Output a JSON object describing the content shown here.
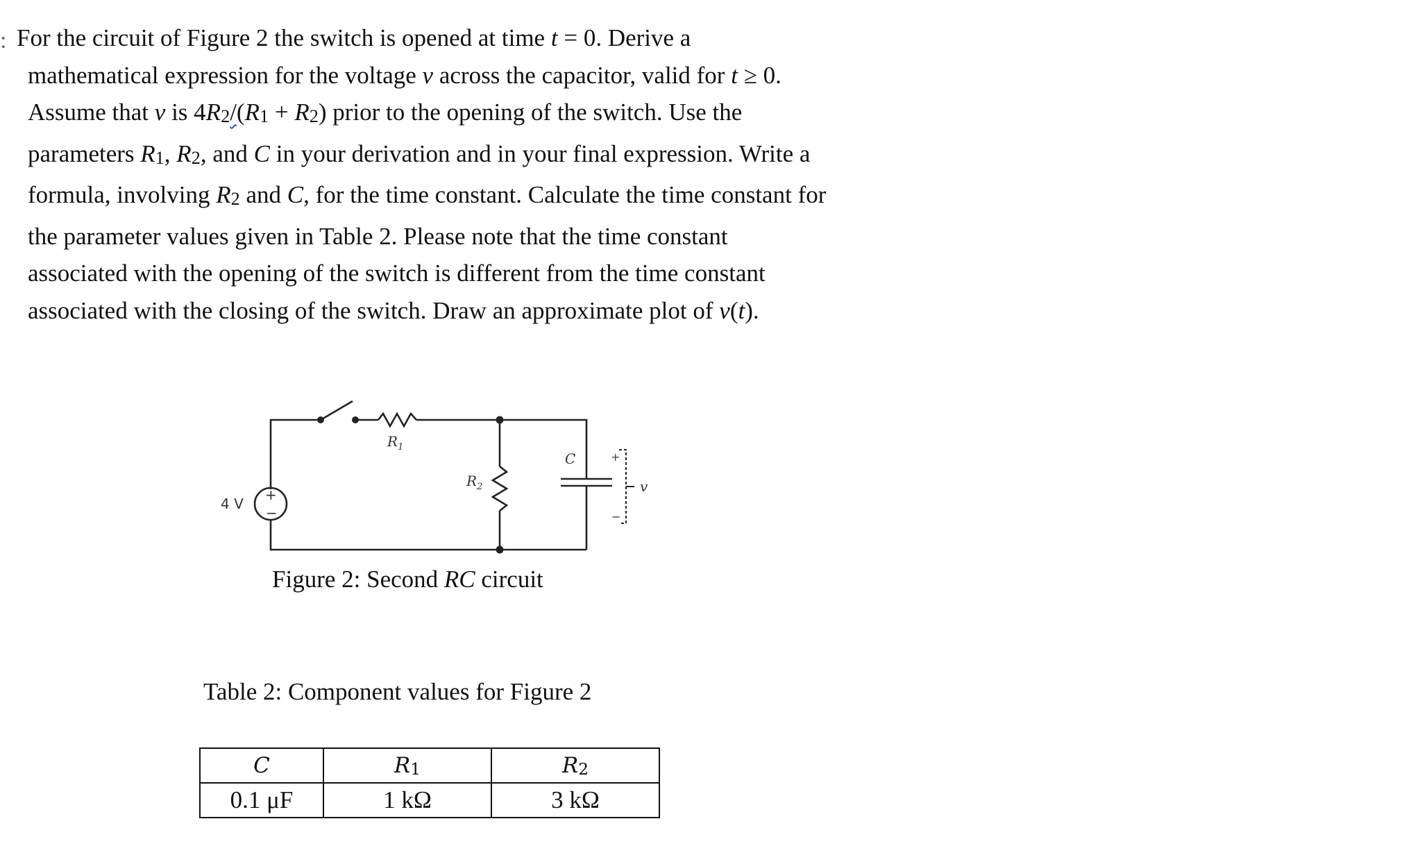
{
  "problem": {
    "bullet": ":",
    "lines": [
      {
        "parts": [
          "For the circuit of Figure 2 the switch is opened at time ",
          {
            "math": "t"
          },
          " = 0.  Derive a"
        ]
      },
      {
        "parts": [
          "mathematical expression for the voltage ",
          {
            "math": "v"
          },
          " across the capacitor, valid for ",
          {
            "math": "t"
          },
          " ≥ 0."
        ]
      },
      {
        "parts": [
          "Assume that ",
          {
            "math": "v"
          },
          " is 4",
          {
            "math": "R",
            "sub": "2"
          },
          {
            "squiggle": "/"
          },
          "(",
          {
            "math": "R",
            "sub": "1"
          },
          " + ",
          {
            "math": "R",
            "sub": "2"
          },
          ") prior to the opening of the switch.  Use the"
        ]
      },
      {
        "parts": [
          "parameters ",
          {
            "math": "R",
            "sub": "1"
          },
          ", ",
          {
            "math": "R",
            "sub": "2"
          },
          ", and ",
          {
            "math": "C"
          },
          " in your derivation and in your final expression.  Write a"
        ]
      },
      {
        "parts": [
          "formula, involving ",
          {
            "math": "R",
            "sub": "2"
          },
          " and ",
          {
            "math": "C"
          },
          ", for the time constant.  Calculate the time constant for"
        ]
      },
      {
        "parts": [
          "the parameter values given in Table 2.  Please note that the time constant"
        ]
      },
      {
        "parts": [
          "associated with the opening of the switch is different from the time constant"
        ]
      },
      {
        "parts": [
          "associated with the closing of the switch.  Draw an approximate plot of ",
          {
            "math": "v"
          },
          "(",
          {
            "math": "t"
          },
          ")."
        ]
      }
    ]
  },
  "figure": {
    "source_label": "4 V",
    "source_plus": "+",
    "source_minus": "−",
    "r1_label": "R",
    "r1_sub": "1",
    "r2_label": "R",
    "r2_sub": "2",
    "c_label": "C",
    "v_plus": "+",
    "v_minus": "−",
    "v_label": "v",
    "caption_prefix": "Figure 2:  Second ",
    "caption_math": "RC",
    "caption_suffix": " circuit"
  },
  "table": {
    "caption": "Table 2:  Component values for Figure 2",
    "headers": [
      {
        "sym": "C",
        "sub": ""
      },
      {
        "sym": "R",
        "sub": "1"
      },
      {
        "sym": "R",
        "sub": "2"
      }
    ],
    "values": [
      "0.1 μF",
      "1 kΩ",
      "3 kΩ"
    ]
  }
}
